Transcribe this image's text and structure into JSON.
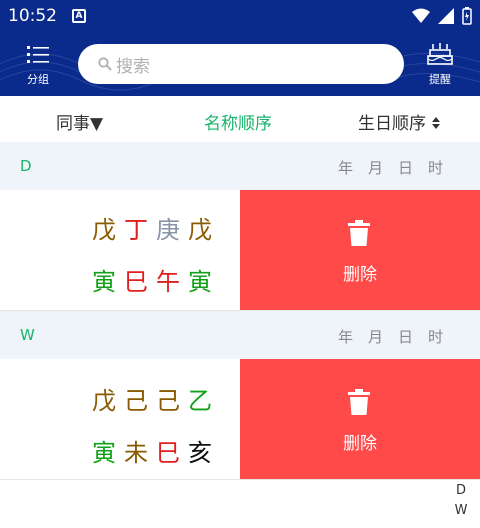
{
  "status": {
    "time": "10:52",
    "notif_letter": "A"
  },
  "header": {
    "group_label": "分组",
    "search_placeholder": "搜索",
    "remind_label": "提醒"
  },
  "sort": {
    "group": "同事▼",
    "name": "名称顺序",
    "birthday": "生日顺序"
  },
  "columns": [
    "年",
    "月",
    "日",
    "时"
  ],
  "sections": [
    {
      "letter": "D",
      "top_stems": [
        "戊",
        "丁",
        "庚",
        "戊"
      ],
      "bottom_branches": [
        "寅",
        "巳",
        "午",
        "寅"
      ],
      "delete_label": "删除"
    },
    {
      "letter": "W",
      "top_stems": [
        "戊",
        "己",
        "己",
        "乙"
      ],
      "bottom_branches": [
        "寅",
        "未",
        "巳",
        "亥"
      ],
      "delete_label": "删除"
    }
  ],
  "index": [
    "D",
    "W"
  ],
  "colors": {
    "header_bg": "#0a2a8c",
    "accent_green": "#19b36b",
    "delete_red": "#ff4a4a"
  }
}
